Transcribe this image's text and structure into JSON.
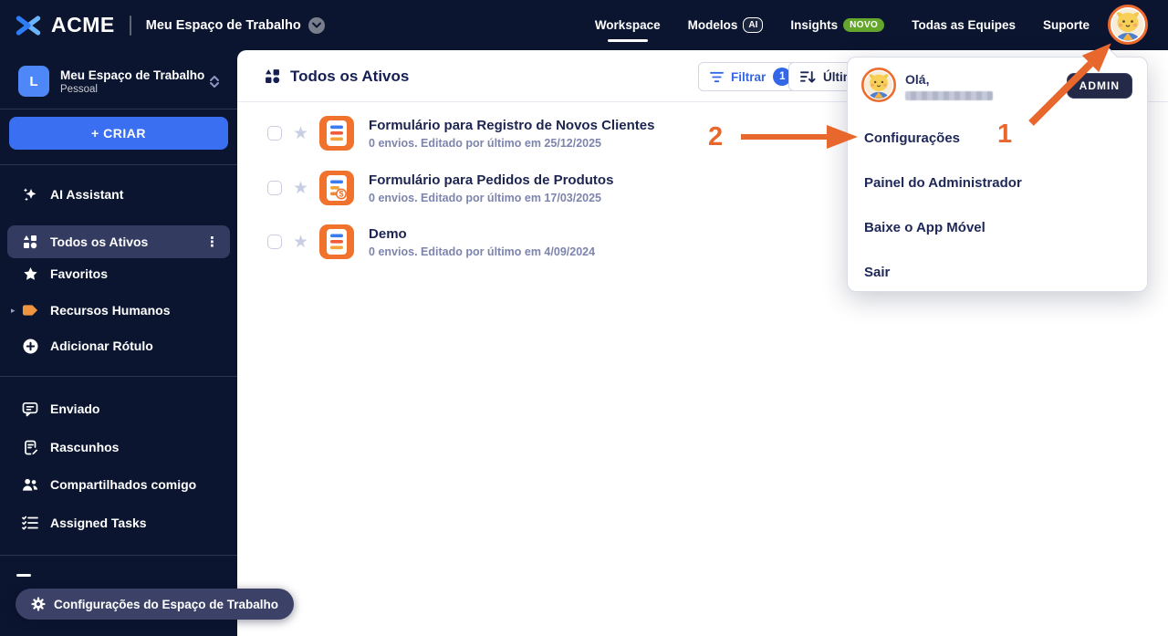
{
  "topbar": {
    "brand": "ACME",
    "workspace_switcher": "Meu Espaço de Trabalho",
    "nav": [
      {
        "label": "Workspace"
      },
      {
        "label": "Modelos",
        "badge": "AI"
      },
      {
        "label": "Insights",
        "badge": "NOVO"
      },
      {
        "label": "Todas as Equipes"
      },
      {
        "label": "Suporte"
      }
    ]
  },
  "sidebar": {
    "workspace": {
      "initial": "L",
      "name": "Meu Espaço de Trabalho",
      "subtitle": "Pessoal"
    },
    "create_label": "+ CRIAR",
    "items": [
      {
        "label": "AI Assistant"
      },
      {
        "label": "Todos os Ativos",
        "selected": true
      },
      {
        "label": "Favoritos"
      },
      {
        "label": "Recursos Humanos"
      },
      {
        "label": "Adicionar Rótulo"
      },
      {
        "label": "Enviado"
      },
      {
        "label": "Rascunhos"
      },
      {
        "label": "Compartilhados comigo"
      },
      {
        "label": "Assigned Tasks"
      }
    ],
    "footer_pill": "Configurações do Espaço de Trabalho"
  },
  "main": {
    "title": "Todos os Ativos",
    "filter_button": {
      "label": "Filtrar",
      "count": "1"
    },
    "sort_button": {
      "label": "Últim"
    },
    "assets": [
      {
        "title": "Formulário para Registro de Novos Clientes",
        "meta": "0 envios. Editado por último em 25/12/2025",
        "icon": "form-icon"
      },
      {
        "title": "Formulário para Pedidos de Produtos",
        "meta": "0 envios. Editado por último em 17/03/2025",
        "icon": "form-money-icon"
      },
      {
        "title": "Demo",
        "meta": "0 envios. Editado por último em 4/09/2024",
        "icon": "form-icon"
      }
    ]
  },
  "user_menu": {
    "greeting": "Olá,",
    "role_badge": "ADMIN",
    "items": [
      {
        "label": "Configurações"
      },
      {
        "label": "Painel do Administrador"
      },
      {
        "label": "Baixe o App Móvel"
      },
      {
        "label": "Sair"
      }
    ]
  },
  "annotations": {
    "step_1": "1",
    "step_2": "2"
  },
  "colors": {
    "navy_background": "#0b1530",
    "accent_blue": "#3a6ff2",
    "accent_orange": "#f0722c",
    "annotation_orange": "#e8672c",
    "badge_green": "#64a52c",
    "admin_badge_navy": "#232946"
  }
}
